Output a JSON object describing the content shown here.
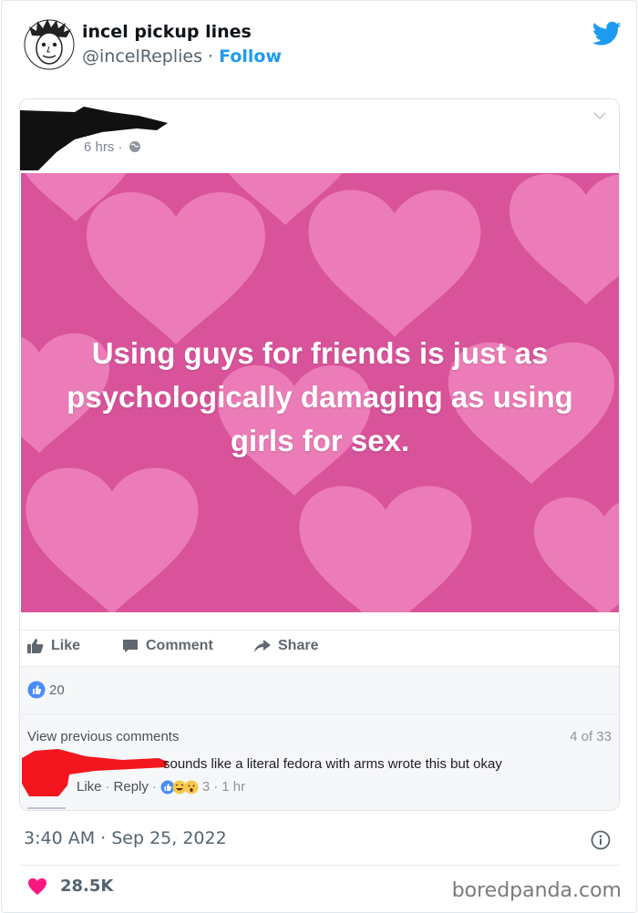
{
  "tweet": {
    "display_name": "incel pickup lines",
    "handle": "@incelReplies",
    "separator": " · ",
    "follow_label": "Follow",
    "timestamp": "3:40 AM · Sep 25, 2022",
    "like_count": "28.5K",
    "icons": {
      "brand": "bird-icon",
      "info": "info-icon",
      "like": "heart-icon"
    },
    "colors": {
      "accent": "#1d9bf0",
      "heart": "#f91880",
      "text_secondary": "#536471"
    }
  },
  "embedded_post": {
    "time": "6 hrs ·",
    "image_text": "Using guys for friends is just as psychologically damaging as using girls for sex.",
    "actions": [
      {
        "label": "Like",
        "icon": "thumbs-up-icon"
      },
      {
        "label": "Comment",
        "icon": "comment-icon"
      },
      {
        "label": "Share",
        "icon": "share-icon"
      }
    ],
    "reaction_count": "20",
    "view_previous": "View previous comments",
    "comment_page": "4 of 33",
    "comment": {
      "text": "sounds like a literal fedora with arms wrote this but okay",
      "like": "Like",
      "reply": "Reply",
      "dot": "·",
      "reaction_count": "3",
      "time": "1 hr"
    },
    "colors": {
      "image_bg": "#d9539b",
      "heart_light": "#ec7fb9"
    }
  },
  "watermark": "boredpanda.com"
}
